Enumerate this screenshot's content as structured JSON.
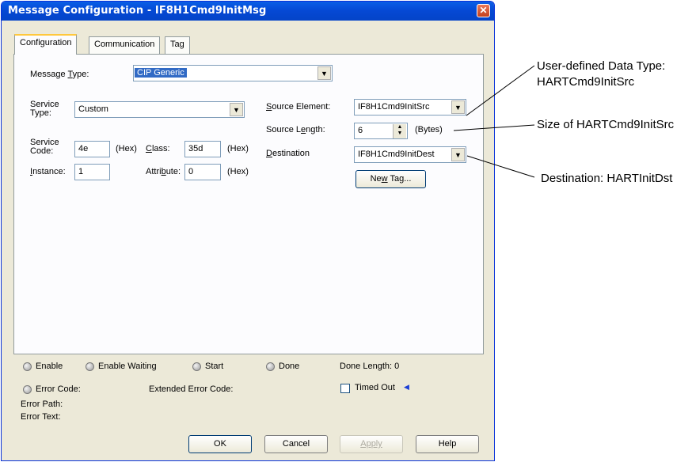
{
  "window": {
    "title": "Message Configuration - IF8H1Cmd9InitMsg",
    "close_label": "✕"
  },
  "tabs": [
    {
      "label": "Configuration",
      "active": true
    },
    {
      "label": "Communication",
      "active": false
    },
    {
      "label": "Tag",
      "active": false
    }
  ],
  "config": {
    "message_type_label_pre": "Message ",
    "message_type_label_ul": "T",
    "message_type_label_post": "ype:",
    "message_type_value": "CIP Generic",
    "service_type_label_1": "Service",
    "service_type_label_2": "Type:",
    "service_type_value": "Custom",
    "service_code_label_1": "Service",
    "service_code_label_2": "Code:",
    "service_code_value": "4e",
    "hex_label": "(Hex)",
    "class_label_ul": "C",
    "class_label_post": "lass:",
    "class_value": "35d",
    "instance_label_ul": "I",
    "instance_label_post": "nstance:",
    "instance_value": "1",
    "attribute_label_pre": "Attri",
    "attribute_label_ul": "b",
    "attribute_label_post": "ute:",
    "attribute_value": "0",
    "source_element_label_ul": "S",
    "source_element_label_post": "ource Element:",
    "source_element_value": "IF8H1Cmd9InitSrc",
    "source_length_label_pre": "Source L",
    "source_length_label_ul": "e",
    "source_length_label_post": "ngth:",
    "source_length_value": "6",
    "bytes_label": "(Bytes)",
    "destination_label_ul": "D",
    "destination_label_post": "estination",
    "destination_value": "IF8H1Cmd9InitDest",
    "new_tag_pre": "Ne",
    "new_tag_ul": "w",
    "new_tag_post": " Tag..."
  },
  "status": {
    "enable": "Enable",
    "enable_waiting": "Enable Waiting",
    "start": "Start",
    "done": "Done",
    "done_length": "Done Length: 0",
    "error_code": "Error Code:",
    "extended_error_code": "Extended Error Code:",
    "timed_out": "Timed Out",
    "timed_out_arrow": "◀",
    "error_path": "Error Path:",
    "error_text": "Error Text:"
  },
  "buttons": {
    "ok": "OK",
    "cancel": "Cancel",
    "apply": "Apply",
    "help": "Help"
  },
  "annotations": {
    "data_type_line1": "User-defined Data Type:",
    "data_type_line2": "HARTCmd9InitSrc",
    "size": "Size of HARTCmd9InitSrc",
    "destination": "Destination: HARTInitDst"
  },
  "colors": {
    "titlebar": "#0548d4",
    "window_bg": "#ece9d8",
    "selection": "#316ac5",
    "tab_highlight": "#ffc83c",
    "timed_out_arrow": "#1c3fd6"
  }
}
